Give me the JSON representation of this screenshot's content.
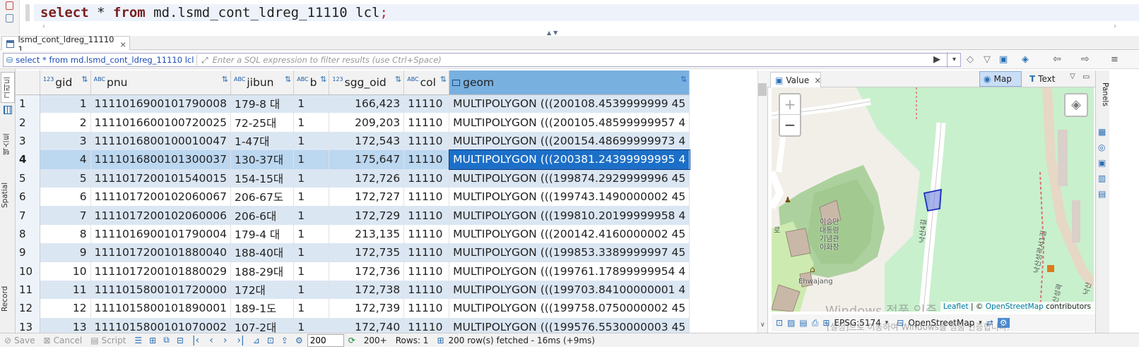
{
  "editor": {
    "kw_select": "select",
    "star": " * ",
    "kw_from": "from",
    "table_ref": " md.lsmd_cont_ldreg_11110 lcl",
    "semicolon": ";"
  },
  "results_tab": {
    "label": "lsmd_cont_ldreg_11110 1",
    "close": "×"
  },
  "filter": {
    "sql": "select * from md.lsmd_cont_ldreg_11110 lcl",
    "placeholder": "Enter a SQL expression to filter results (use Ctrl+Space)"
  },
  "left_tabs": {
    "grid": "그리드",
    "text": "텍스트",
    "spatial": "Spatial",
    "record": "Record"
  },
  "columns": [
    {
      "type": "123",
      "name": "gid"
    },
    {
      "type": "ABC",
      "name": "pnu"
    },
    {
      "type": "ABC",
      "name": "jibun"
    },
    {
      "type": "ABC",
      "name": "b"
    },
    {
      "type": "123",
      "name": "sgg_oid"
    },
    {
      "type": "ABC",
      "name": "col"
    },
    {
      "type": "",
      "name": "geom"
    }
  ],
  "rows": [
    {
      "n": "1",
      "gid": "1",
      "pnu": "1111016900101790008",
      "jibun": "179-8 대",
      "b": "1",
      "sgg_oid": "166,423",
      "col": "11110",
      "geom": "MULTIPOLYGON (((200108.4539999999 45"
    },
    {
      "n": "2",
      "gid": "2",
      "pnu": "1111016600100720025",
      "jibun": "72-25대",
      "b": "1",
      "sgg_oid": "209,203",
      "col": "11110",
      "geom": "MULTIPOLYGON (((200105.48599999957 4"
    },
    {
      "n": "3",
      "gid": "3",
      "pnu": "1111016800100010047",
      "jibun": "1-47대",
      "b": "1",
      "sgg_oid": "172,543",
      "col": "11110",
      "geom": "MULTIPOLYGON (((200154.48699999973 4"
    },
    {
      "n": "4",
      "gid": "4",
      "pnu": "1111016800101300037",
      "jibun": "130-37대",
      "b": "1",
      "sgg_oid": "175,647",
      "col": "11110",
      "geom": "MULTIPOLYGON (((200381.24399999995 4"
    },
    {
      "n": "5",
      "gid": "5",
      "pnu": "1111017200101540015",
      "jibun": "154-15대",
      "b": "1",
      "sgg_oid": "172,726",
      "col": "11110",
      "geom": "MULTIPOLYGON (((199874.2929999996 45"
    },
    {
      "n": "6",
      "gid": "6",
      "pnu": "1111017200102060067",
      "jibun": "206-67도",
      "b": "1",
      "sgg_oid": "172,727",
      "col": "11110",
      "geom": "MULTIPOLYGON (((199743.1490000002 45"
    },
    {
      "n": "7",
      "gid": "7",
      "pnu": "1111017200102060006",
      "jibun": "206-6대",
      "b": "1",
      "sgg_oid": "172,729",
      "col": "11110",
      "geom": "MULTIPOLYGON (((199810.20199999958 4"
    },
    {
      "n": "8",
      "gid": "8",
      "pnu": "1111016900101790004",
      "jibun": "179-4 대",
      "b": "1",
      "sgg_oid": "213,135",
      "col": "11110",
      "geom": "MULTIPOLYGON (((200142.4160000002 45"
    },
    {
      "n": "9",
      "gid": "9",
      "pnu": "1111017200101880040",
      "jibun": "188-40대",
      "b": "1",
      "sgg_oid": "172,735",
      "col": "11110",
      "geom": "MULTIPOLYGON (((199853.3389999997 45"
    },
    {
      "n": "10",
      "gid": "10",
      "pnu": "1111017200101880029",
      "jibun": "188-29대",
      "b": "1",
      "sgg_oid": "172,736",
      "col": "11110",
      "geom": "MULTIPOLYGON (((199761.17899999954 4"
    },
    {
      "n": "11",
      "gid": "11",
      "pnu": "1111015800101720000",
      "jibun": "172대",
      "b": "1",
      "sgg_oid": "172,738",
      "col": "11110",
      "geom": "MULTIPOLYGON (((199703.84100000001 4"
    },
    {
      "n": "12",
      "gid": "12",
      "pnu": "1111015800101890001",
      "jibun": "189-1도",
      "b": "1",
      "sgg_oid": "172,739",
      "col": "11110",
      "geom": "MULTIPOLYGON (((199758.0750000002 45"
    },
    {
      "n": "13",
      "gid": "13",
      "pnu": "1111015800101070002",
      "jibun": "107-2대",
      "b": "1",
      "sgg_oid": "172,740",
      "col": "11110",
      "geom": "MULTIPOLYGON (((199576.5530000003 45"
    }
  ],
  "value_panel": {
    "tab_label": "Value",
    "map_btn": "Map",
    "text_btn": "Text",
    "zoom_in": "+",
    "zoom_out": "−",
    "map_labels": {
      "memorial": "이승만\n대통령\n기념관\n이화장",
      "ehwajang": "Ehwajang",
      "road1": "낙산4길",
      "road2": "낙산성곽서1길",
      "road3": "낙산",
      "road4": "낙산성곽",
      "road5": "로"
    },
    "attribution_leaflet": "Leaflet",
    "attribution_sep": " | © ",
    "attribution_osm": "OpenStreetMap",
    "attribution_tail": " contributors",
    "crs": "EPSG:5174",
    "basemap": "OpenStreetMap",
    "watermark1": "Windows 정품 인증",
    "watermark2": "[설정]으로 이동하여 Windows를 정품 인증합니다."
  },
  "panels_label": "Panels",
  "status": {
    "save": "Save",
    "cancel": "Cancel",
    "script": "Script",
    "fetch_size": "200",
    "fetch_more": "200+",
    "rows": "Rows: 1",
    "fetched": "200 row(s) fetched - 16ms (+9ms)"
  }
}
